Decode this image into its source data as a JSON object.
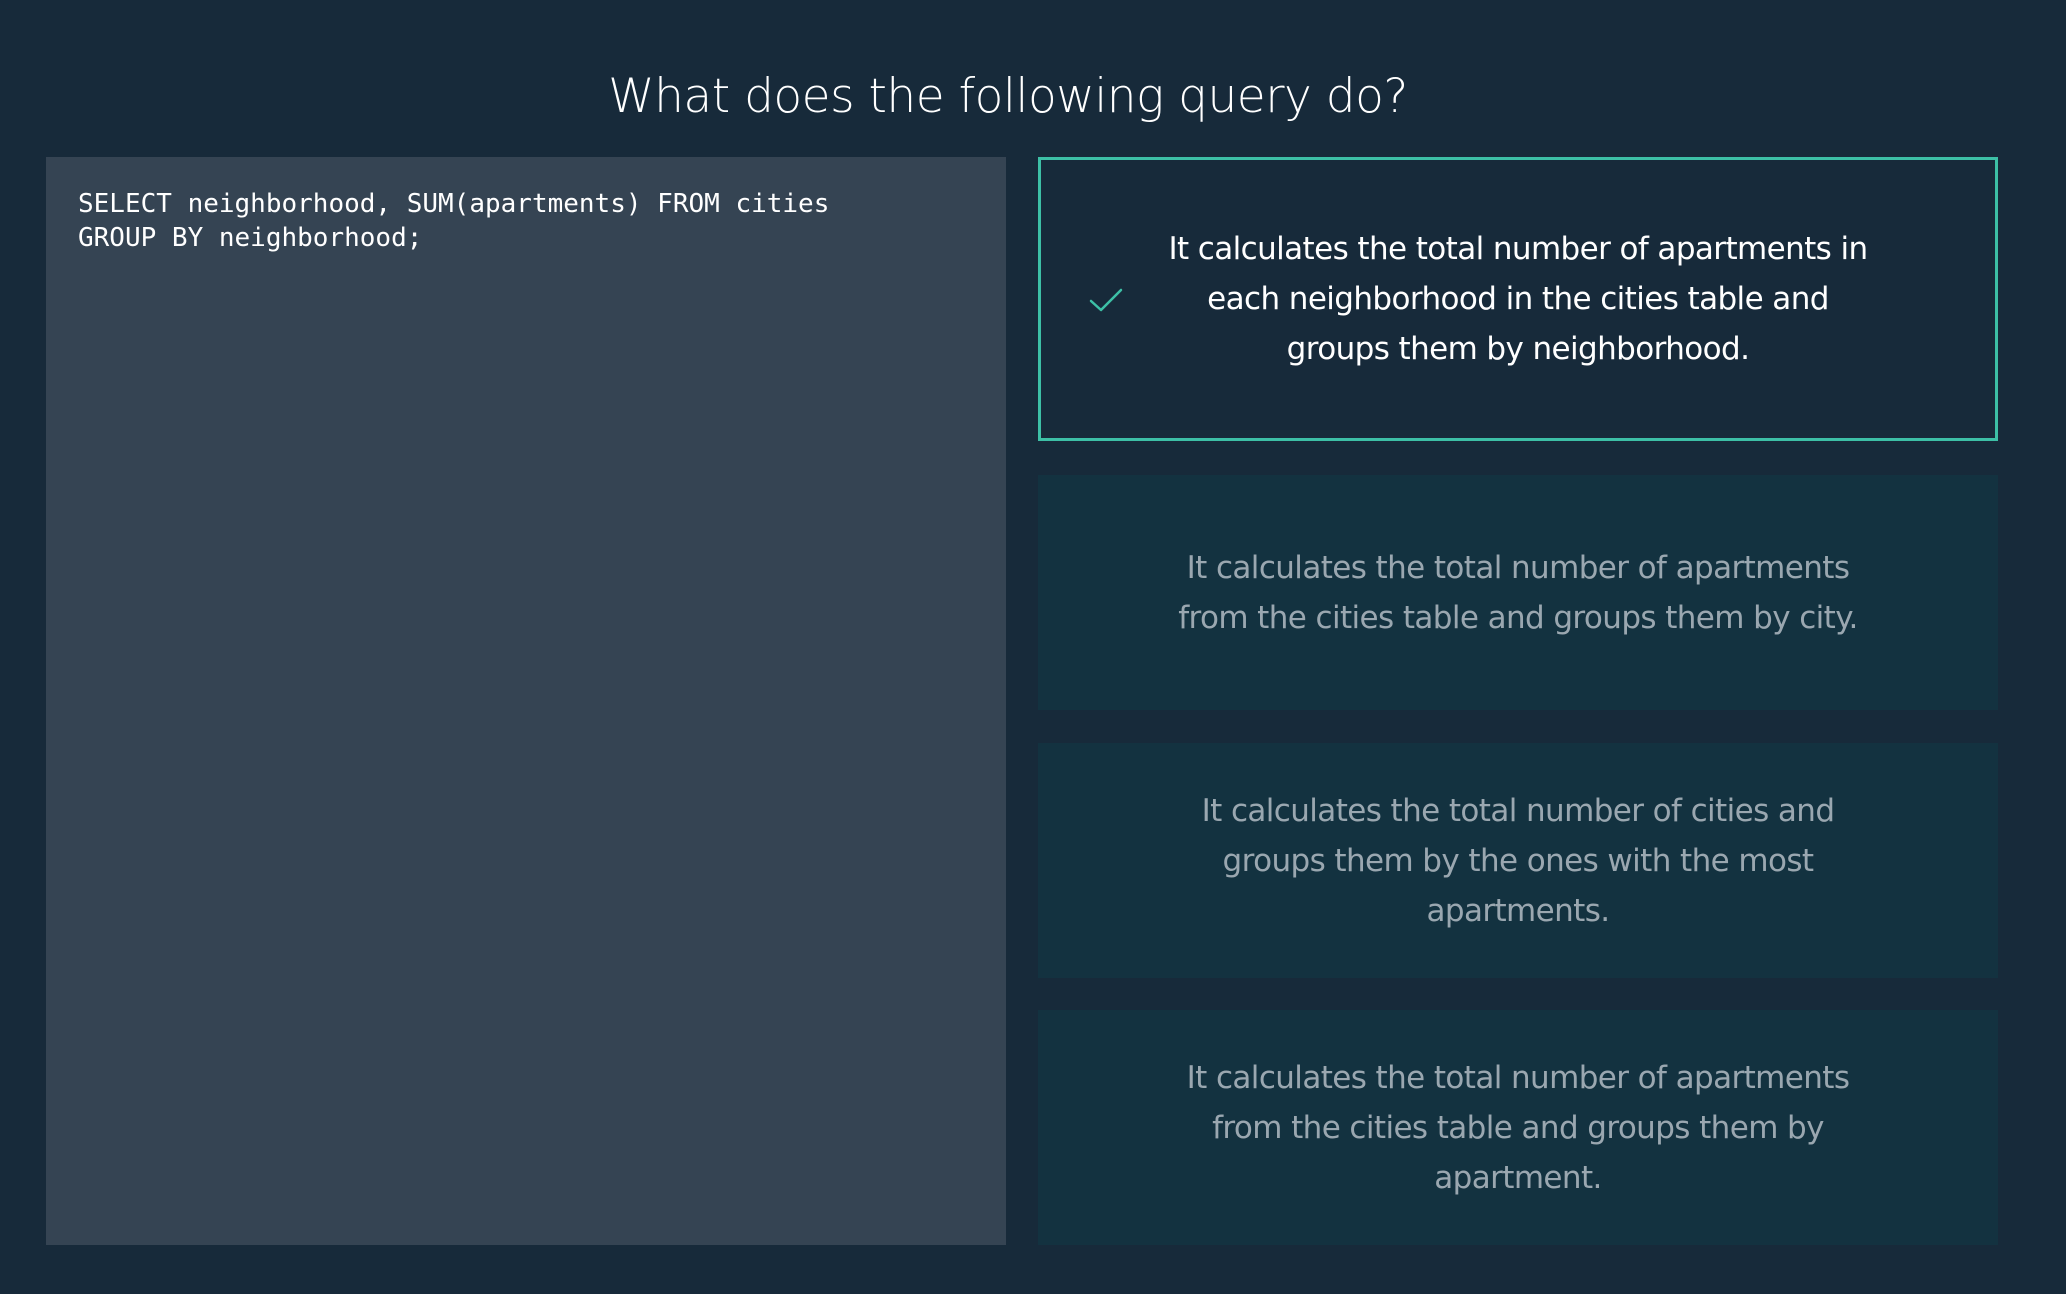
{
  "question": {
    "title": "What does the following query do?"
  },
  "code": {
    "text": "SELECT neighborhood, SUM(apartments) FROM cities\nGROUP BY neighborhood;"
  },
  "answers": [
    {
      "text": "It calculates the total number of apartments in each neighborhood in the cities table and groups them by neighborhood.",
      "state": "correct",
      "icon": "check-icon"
    },
    {
      "text": "It calculates the total number of apartments from the cities table and groups them by city.",
      "state": "unselected"
    },
    {
      "text": "It calculates the total number of cities and groups them by the ones with the most apartments.",
      "state": "unselected"
    },
    {
      "text": "It calculates the total number of apartments from the cities table and groups them by apartment.",
      "state": "unselected"
    }
  ],
  "colors": {
    "background": "#172a3a",
    "code_panel": "#354453",
    "option_background": "#133240",
    "correct_accent": "#3dc0a6",
    "muted_text": "#9aa7b0"
  }
}
